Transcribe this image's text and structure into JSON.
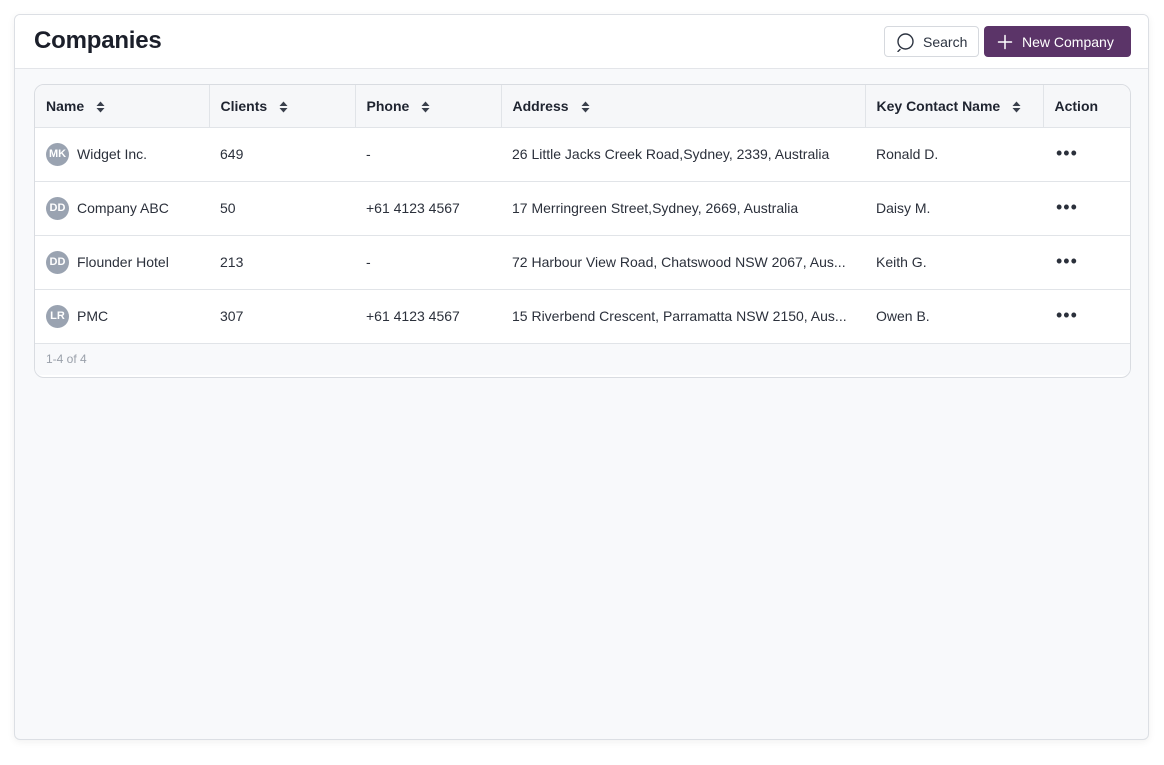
{
  "header": {
    "title": "Companies",
    "search_label": "Search",
    "new_label": "New Company"
  },
  "table": {
    "columns": [
      {
        "label": "Name",
        "sortable": true
      },
      {
        "label": "Clients",
        "sortable": true
      },
      {
        "label": "Phone",
        "sortable": true
      },
      {
        "label": "Address",
        "sortable": true
      },
      {
        "label": "Key Contact Name",
        "sortable": true
      },
      {
        "label": "Action",
        "sortable": false
      }
    ],
    "rows": [
      {
        "initials": "MK",
        "name": "Widget Inc.",
        "clients": "649",
        "phone": "-",
        "address": "26 Little Jacks Creek Road,Sydney, 2339, Australia",
        "contact": "Ronald D.",
        "action": "•••"
      },
      {
        "initials": "DD",
        "name": "Company ABC",
        "clients": "50",
        "phone": "+61 4123 4567",
        "address": "17 Merringreen Street,Sydney, 2669, Australia",
        "contact": "Daisy M.",
        "action": "•••"
      },
      {
        "initials": "DD",
        "name": "Flounder Hotel",
        "clients": "213",
        "phone": "-",
        "address": "72 Harbour View Road, Chatswood NSW 2067, Aus...",
        "contact": "Keith G.",
        "action": "•••"
      },
      {
        "initials": "LR",
        "name": "PMC",
        "clients": "307",
        "phone": "+61 4123 4567",
        "address": "15 Riverbend Crescent, Parramatta NSW 2150, Aus...",
        "contact": "Owen B.",
        "action": "•••"
      }
    ],
    "footer": "1-4 of 4"
  },
  "colors": {
    "accent": "#5b3468",
    "avatar": "#9aa3b1"
  }
}
